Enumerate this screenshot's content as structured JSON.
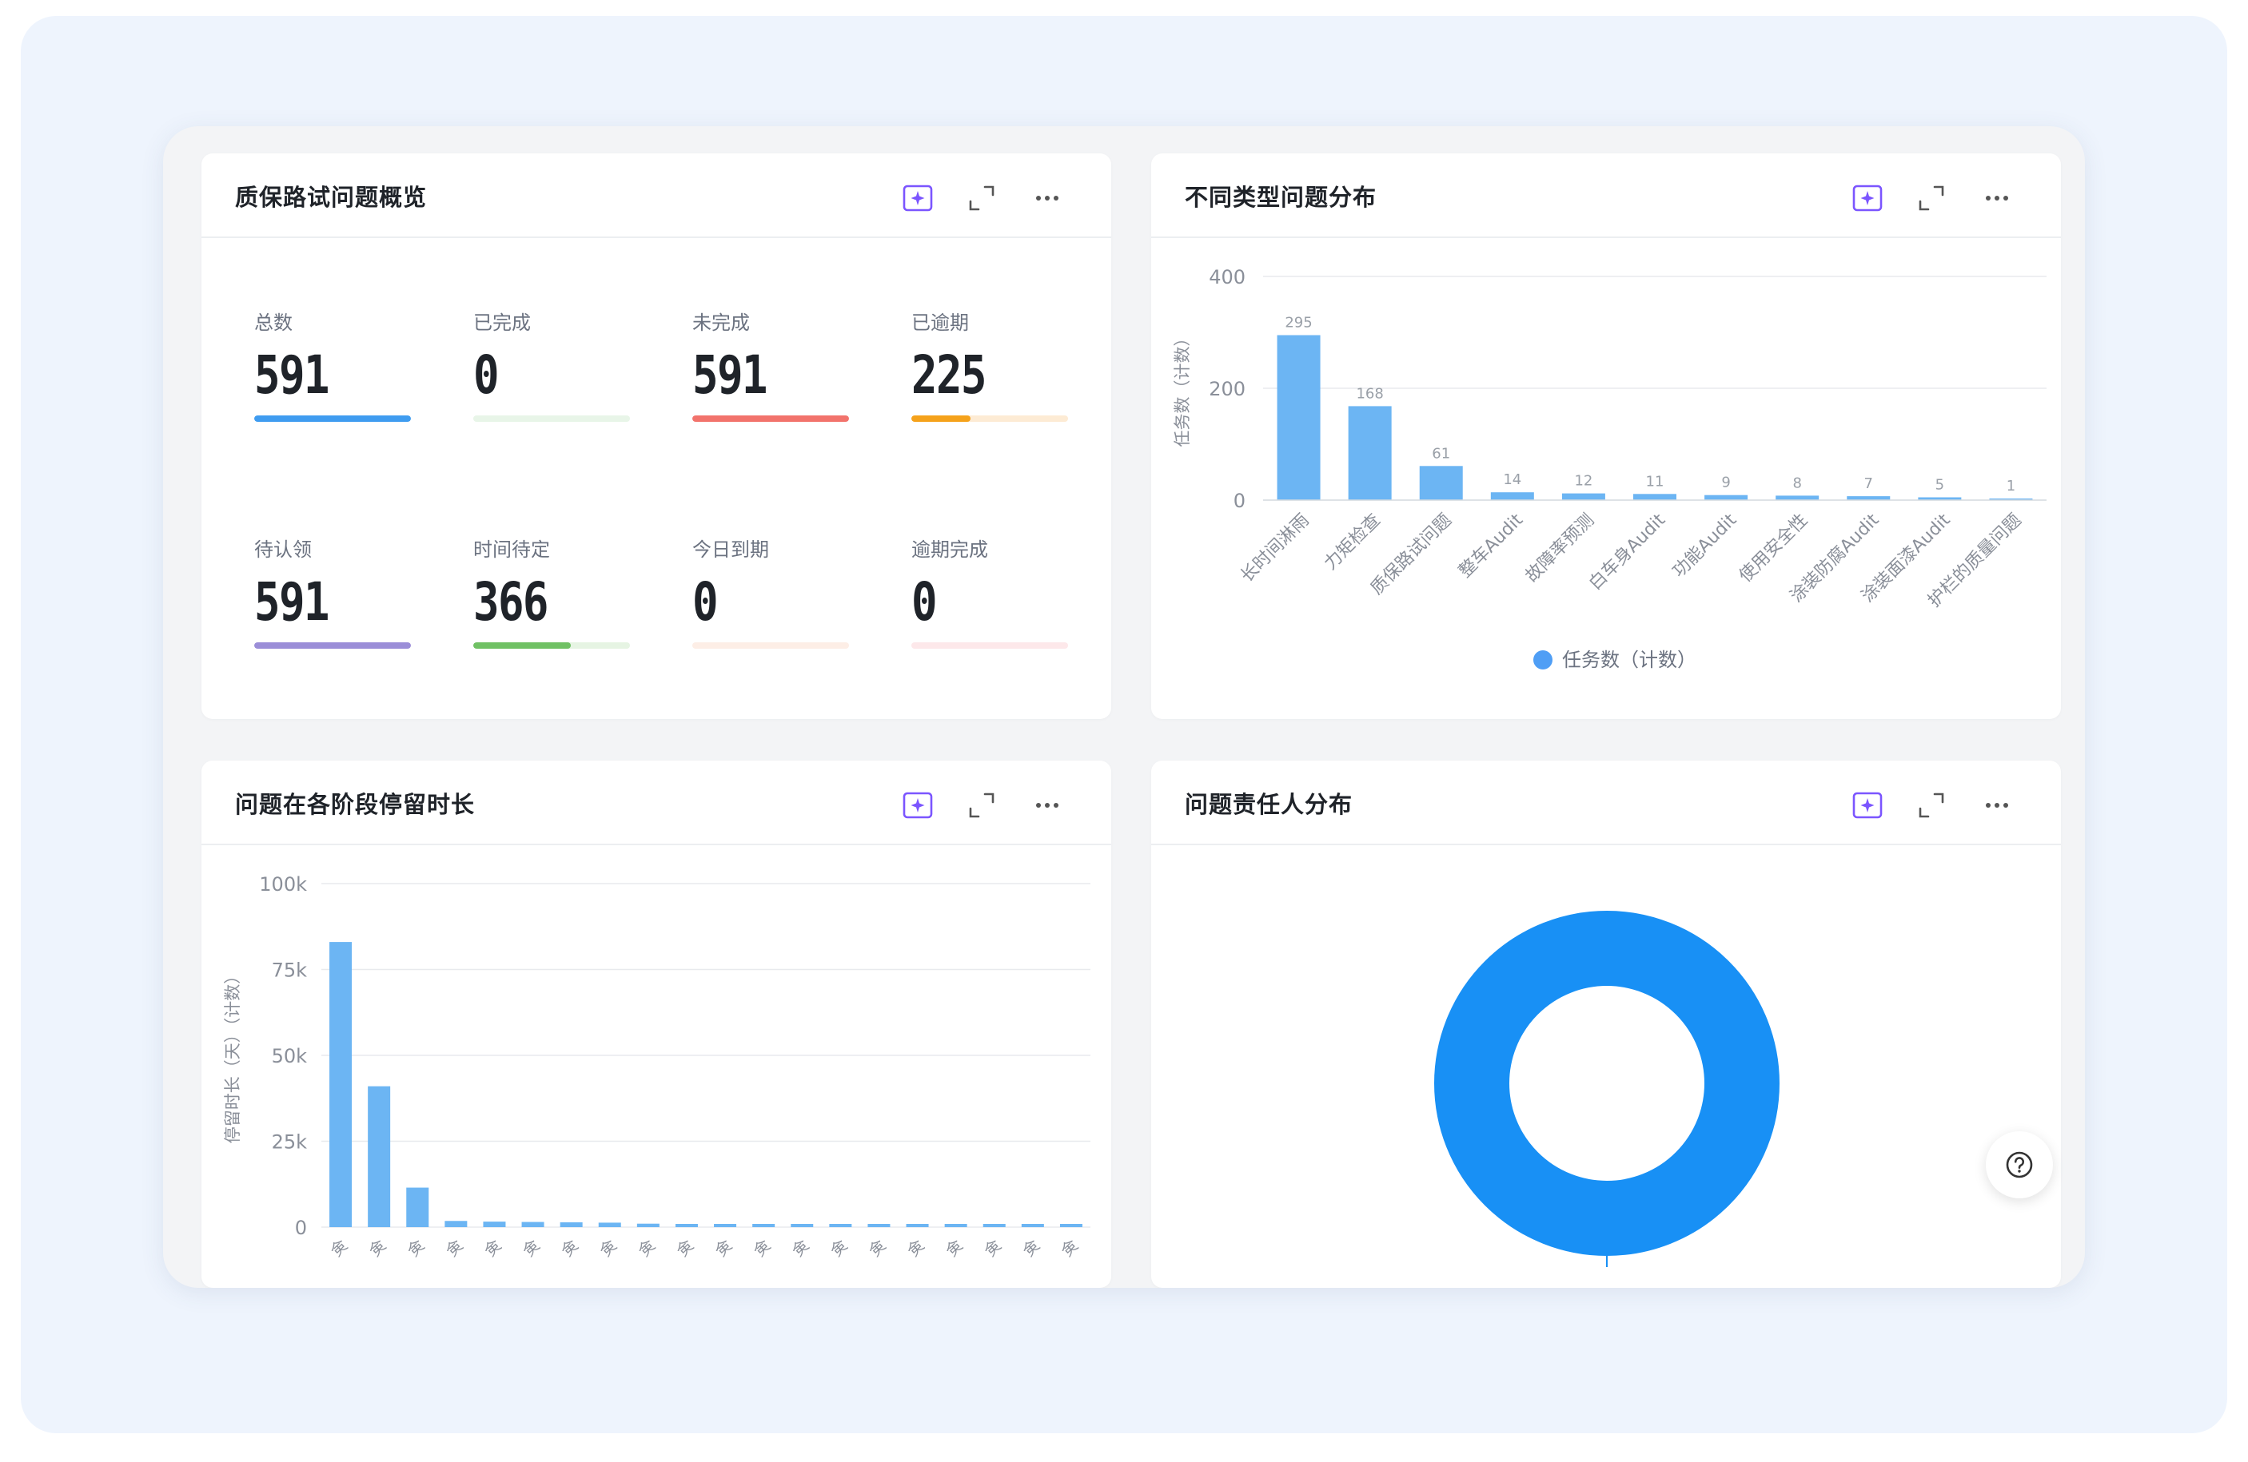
{
  "colors": {
    "accent": "#4f9ef5",
    "bar": "#6cb5f3",
    "donut": "#1890f5",
    "ai_icon": "#7b55ff"
  },
  "toolbar_icons": [
    "ai-insight-icon",
    "fullscreen-icon",
    "more-icon"
  ],
  "overview": {
    "title": "质保路试问题概览",
    "stats": [
      {
        "label": "总数",
        "value": "591",
        "progress": 1.0,
        "color": "#3f9cf0",
        "track": "#e3f0fd"
      },
      {
        "label": "已完成",
        "value": "0",
        "progress": 0.0,
        "color": "#68c068",
        "track": "#e8f5e8"
      },
      {
        "label": "未完成",
        "value": "591",
        "progress": 1.0,
        "color": "#f2736c",
        "track": "#fde6e4"
      },
      {
        "label": "已逾期",
        "value": "225",
        "progress": 0.38,
        "color": "#f5a21b",
        "track": "#fdebd4"
      },
      {
        "label": "待认领",
        "value": "591",
        "progress": 1.0,
        "color": "#9b8ed8",
        "track": "#ece9f8"
      },
      {
        "label": "时间待定",
        "value": "366",
        "progress": 0.62,
        "color": "#70c164",
        "track": "#e6f4e3"
      },
      {
        "label": "今日到期",
        "value": "0",
        "progress": 0.0,
        "color": "#f3a98c",
        "track": "#fdeee6"
      },
      {
        "label": "逾期完成",
        "value": "0",
        "progress": 0.0,
        "color": "#f3a0a8",
        "track": "#fde8ea"
      }
    ]
  },
  "type_dist": {
    "title": "不同类型问题分布",
    "chart_data": {
      "type": "bar",
      "categories": [
        "长时间淋雨",
        "力矩检查",
        "质保路试问题",
        "整车Audit",
        "故障率预测",
        "白车身Audit",
        "功能Audit",
        "使用安全性",
        "涂装防腐Audit",
        "涂装面漆Audit",
        "护栏的质量问题"
      ],
      "values": [
        295,
        168,
        61,
        14,
        12,
        11,
        9,
        8,
        7,
        5,
        1
      ],
      "ylabel": "任务数（计数）",
      "yticks": [
        0,
        200,
        400
      ],
      "ylim": [
        0,
        400
      ],
      "grid": true,
      "legend": {
        "label": "任务数（计数）",
        "placement": "bottom"
      }
    }
  },
  "stage_duration": {
    "title": "问题在各阶段停留时长",
    "chart_data": {
      "type": "bar",
      "categories": [
        "㑒",
        "㑒",
        "㑒",
        "㑒",
        "㑒",
        "㑒",
        "㑒",
        "㑒",
        "㑒",
        "㑒",
        "㑒",
        "㑒",
        "㑒",
        "㑒",
        "㑒",
        "㑒",
        "㑒",
        "㑒",
        "㑒",
        "㑒"
      ],
      "values": [
        83000,
        41000,
        11500,
        1800,
        1600,
        1500,
        1400,
        1300,
        1000,
        700,
        600,
        600,
        600,
        500,
        500,
        500,
        500,
        500,
        500,
        500
      ],
      "ylabel": "停留时长（天）（计数）",
      "yticks": [
        "0",
        "25k",
        "50k",
        "75k",
        "100k"
      ],
      "ytick_values": [
        0,
        25000,
        50000,
        75000,
        100000
      ],
      "ylim": [
        0,
        100000
      ],
      "grid": true
    }
  },
  "assignee_dist": {
    "title": "问题责任人分布",
    "chart_data": {
      "type": "pie",
      "donut": true,
      "slices": [
        {
          "value": 1.0,
          "color": "#1890f5"
        }
      ]
    }
  },
  "help": {
    "icon": "help-circle-icon"
  }
}
